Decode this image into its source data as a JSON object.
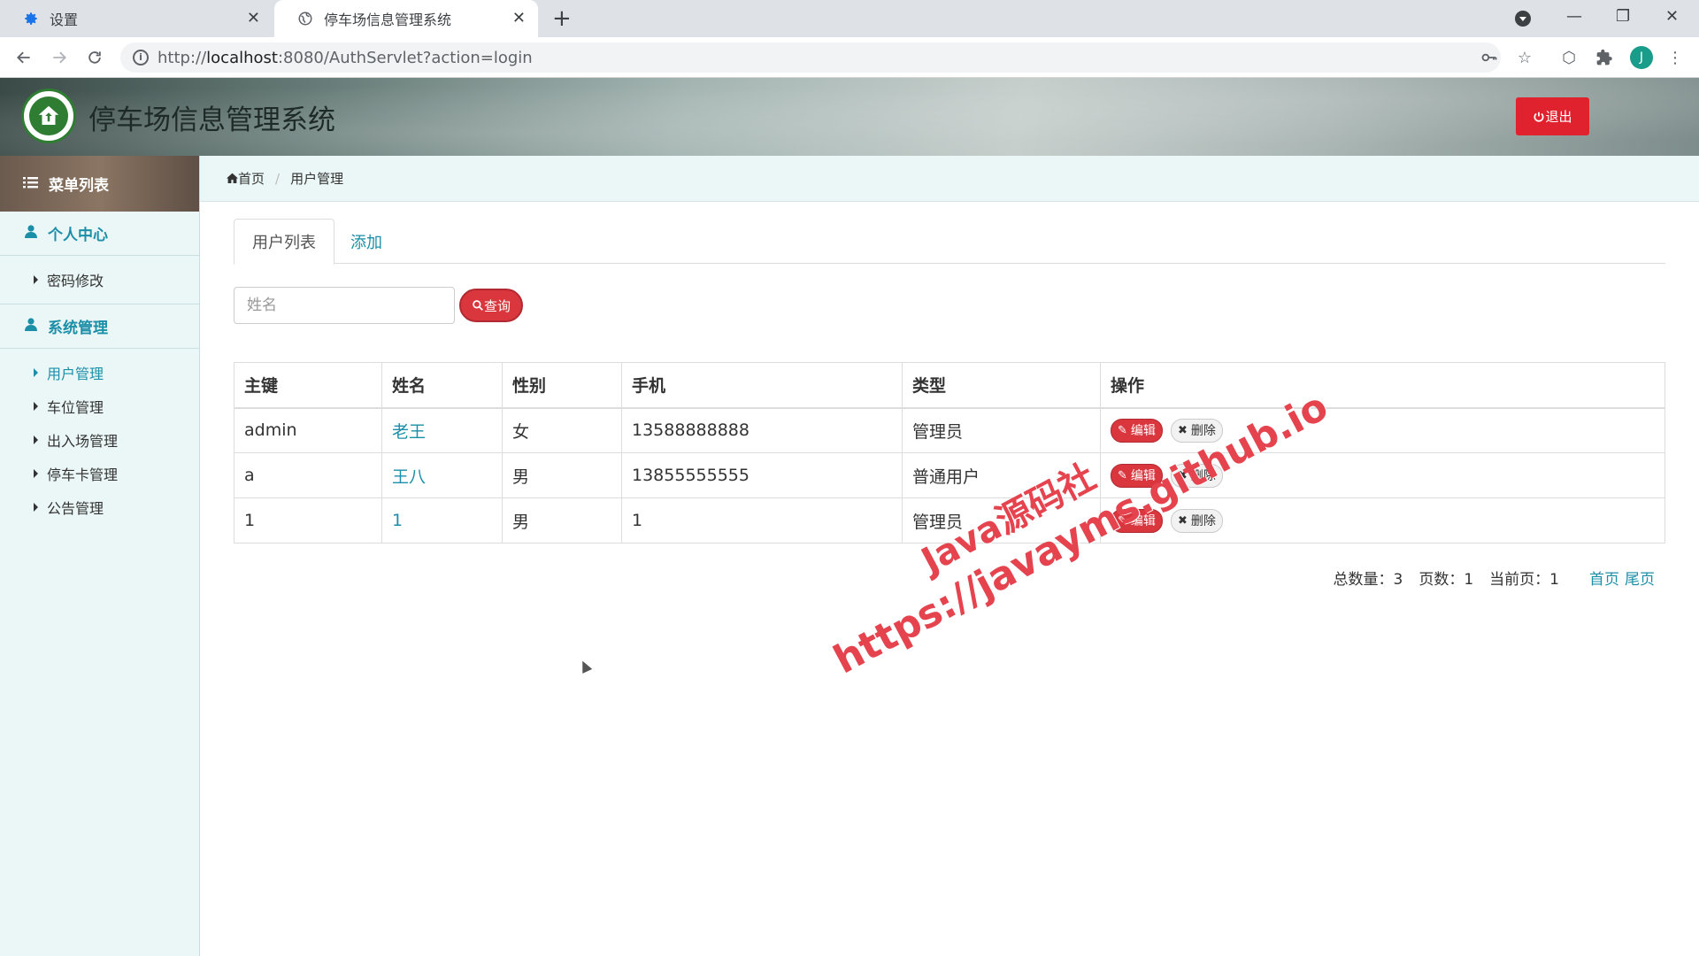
{
  "browser": {
    "tabs": [
      {
        "title": "设置",
        "icon": "gear-icon"
      },
      {
        "title": "停车场信息管理系统",
        "icon": "globe-icon"
      }
    ],
    "url_prefix": "http://",
    "url_host": "localhost",
    "url_rest": ":8080/AuthServlet?action=login",
    "avatar_letter": "J"
  },
  "header": {
    "title": "停车场信息管理系统",
    "logout_label": "退出"
  },
  "sidebar": {
    "menu_title": "菜单列表",
    "groups": [
      {
        "label": "个人中心",
        "items": [
          "密码修改"
        ]
      },
      {
        "label": "系统管理",
        "items": [
          "用户管理",
          "车位管理",
          "出入场管理",
          "停车卡管理",
          "公告管理"
        ]
      }
    ],
    "active_item": "用户管理"
  },
  "breadcrumb": [
    "首页",
    "用户管理"
  ],
  "tabs": [
    "用户列表",
    "添加"
  ],
  "search": {
    "placeholder": "姓名",
    "button_label": "查询"
  },
  "table": {
    "headers": [
      "主键",
      "姓名",
      "性别",
      "手机",
      "类型",
      "操作"
    ],
    "rows": [
      {
        "id": "admin",
        "name": "老王",
        "gender": "女",
        "phone": "13588888888",
        "type": "管理员"
      },
      {
        "id": "a",
        "name": "王八",
        "gender": "男",
        "phone": "13855555555",
        "type": "普通用户"
      },
      {
        "id": "1",
        "name": "1",
        "gender": "男",
        "phone": "1",
        "type": "管理员"
      }
    ],
    "edit_label": "编辑",
    "delete_label": "删除"
  },
  "pagination": {
    "total": "总数量：3",
    "pages": "页数：1",
    "current": "当前页：1",
    "first": "首页",
    "last": "尾页"
  },
  "watermark": {
    "line1": "Java源码社",
    "line2": "https://javayms.github.io"
  },
  "colors": {
    "accent": "#1b8fa8",
    "danger": "#d9363e",
    "logout": "#e0222f"
  }
}
